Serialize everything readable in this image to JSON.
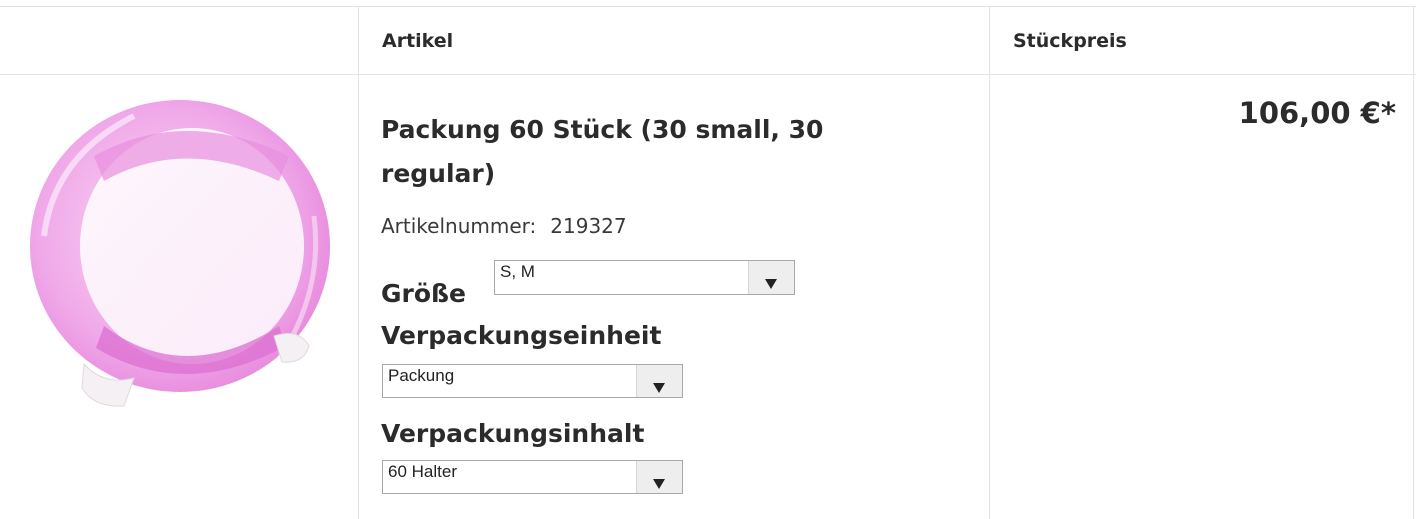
{
  "table": {
    "header_article": "Artikel",
    "header_price": "Stückpreis"
  },
  "product": {
    "image_icon": "pink-ring-holder-image",
    "title": "Packung 60 Stück (30 small, 30 regular)",
    "article_number_label": "Artikelnummer:",
    "article_number": "219327",
    "price": "106,00 €*",
    "options": {
      "size": {
        "label": "Größe",
        "selected": "S, M"
      },
      "packaging_unit": {
        "label": "Verpackungseinheit",
        "selected": "Packung"
      },
      "packaging_content": {
        "label": "Verpackungsinhalt",
        "selected": "60 Halter"
      }
    }
  },
  "colors": {
    "border": "#e3e3e3",
    "text": "#2b2b2b",
    "product_pink": "#e98be0"
  }
}
